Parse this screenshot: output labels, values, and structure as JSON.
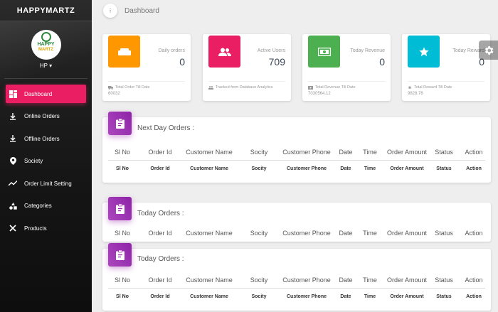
{
  "sidebar": {
    "brand": "HAPPYMARTZ",
    "logo_text_1": "HAPPY",
    "logo_text_2": "MARTZ",
    "user": "HP ▾",
    "items": [
      {
        "label": "Dashboard",
        "icon": "dashboard-icon",
        "active": true
      },
      {
        "label": "Online Orders",
        "icon": "download-icon"
      },
      {
        "label": "Offline Orders",
        "icon": "download-icon"
      },
      {
        "label": "Society",
        "icon": "location-pin-icon"
      },
      {
        "label": "Order Limit Setting",
        "icon": "trending-icon"
      },
      {
        "label": "Categories",
        "icon": "categories-icon"
      },
      {
        "label": "Products",
        "icon": "utensils-icon"
      }
    ]
  },
  "header": {
    "menu_glyph": "⁝",
    "title": "Dashboard"
  },
  "stats": [
    {
      "label": "Daily orders",
      "value": "0",
      "footer": "Total Order Till Date",
      "sub": "60032",
      "color": "#ff9800"
    },
    {
      "label": "Active Users",
      "value": "709",
      "footer": "Tracked from Database Analytics",
      "sub": "",
      "color": "#e91e63"
    },
    {
      "label": "Today Revenue",
      "value": "0",
      "footer": "Total Revenue Till Date",
      "sub": "7030564.12",
      "color": "#4caf50"
    },
    {
      "label": "Today Reward",
      "value": "0",
      "footer": "Total Reward Till Date",
      "sub": "9828.78",
      "color": "#00bcd4"
    }
  ],
  "orders": {
    "columns": [
      "Sl No",
      "Order Id",
      "Customer Name",
      "Socity",
      "Customer Phone",
      "Date",
      "Time",
      "Order Amount",
      "Status",
      "Action"
    ],
    "cards": [
      {
        "title": "Next Day Orders :"
      },
      {
        "title": "Today Orders :"
      },
      {
        "title": "Today Orders :"
      }
    ]
  }
}
